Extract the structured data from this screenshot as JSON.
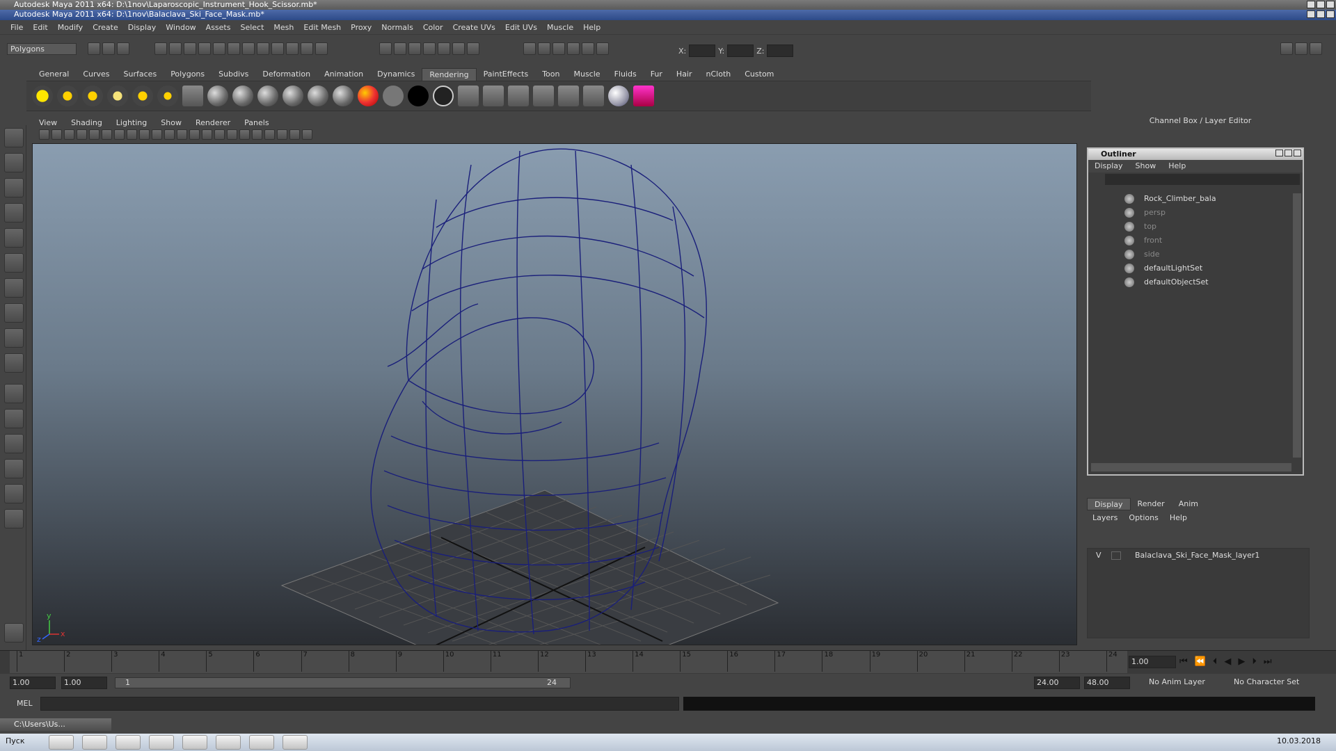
{
  "window": {
    "title_back": "Autodesk Maya 2011 x64: D:\\1nov\\Laparoscopic_Instrument_Hook_Scissor.mb*",
    "title_front": "Autodesk Maya 2011 x64: D:\\1nov\\Balaclava_Ski_Face_Mask.mb*"
  },
  "menu": [
    "File",
    "Edit",
    "Modify",
    "Create",
    "Display",
    "Window",
    "Assets",
    "Select",
    "Mesh",
    "Edit Mesh",
    "Proxy",
    "Normals",
    "Color",
    "Create UVs",
    "Edit UVs",
    "Muscle",
    "Help"
  ],
  "status": {
    "mode": "Polygons",
    "x_label": "X:",
    "y_label": "Y:",
    "z_label": "Z:"
  },
  "shelf_tabs": [
    "General",
    "Curves",
    "Surfaces",
    "Polygons",
    "Subdivs",
    "Deformation",
    "Animation",
    "Dynamics",
    "Rendering",
    "PaintEffects",
    "Toon",
    "Muscle",
    "Fluids",
    "Fur",
    "Hair",
    "nCloth",
    "Custom"
  ],
  "active_shelf": "Rendering",
  "panel_menu": [
    "View",
    "Shading",
    "Lighting",
    "Show",
    "Renderer",
    "Panels"
  ],
  "channel_box_title": "Channel Box / Layer Editor",
  "outliner": {
    "title": "Outliner",
    "menu": [
      "Display",
      "Show",
      "Help"
    ],
    "items": [
      {
        "label": "Rock_Climber_bala",
        "dim": false
      },
      {
        "label": "persp",
        "dim": true
      },
      {
        "label": "top",
        "dim": true
      },
      {
        "label": "front",
        "dim": true
      },
      {
        "label": "side",
        "dim": true
      },
      {
        "label": "defaultLightSet",
        "dim": false
      },
      {
        "label": "defaultObjectSet",
        "dim": false
      }
    ]
  },
  "layers": {
    "tabs": [
      "Display",
      "Render",
      "Anim"
    ],
    "menu": [
      "Layers",
      "Options",
      "Help"
    ],
    "row": {
      "v": "V",
      "name": "Balaclava_Ski_Face_Mask_layer1"
    }
  },
  "timeline": {
    "ticks": [
      "1",
      "2",
      "3",
      "4",
      "5",
      "6",
      "7",
      "8",
      "9",
      "10",
      "11",
      "12",
      "13",
      "14",
      "15",
      "16",
      "17",
      "18",
      "19",
      "20",
      "21",
      "22",
      "23",
      "24"
    ],
    "current": "1",
    "current_field": "1.00"
  },
  "range": {
    "start": "1.00",
    "start2": "1.00",
    "range_start": "1",
    "range_end": "24",
    "end": "24.00",
    "end2": "48.00",
    "anim_layer": "No Anim Layer",
    "char_set": "No Character Set"
  },
  "cmd": {
    "label": "MEL"
  },
  "taskbar": {
    "mini_title": "C:\\Users\\Us...",
    "lang": "Пуск",
    "clock": "10.03.2018"
  },
  "axis": {
    "y": "y",
    "x": "x",
    "z": "z"
  }
}
